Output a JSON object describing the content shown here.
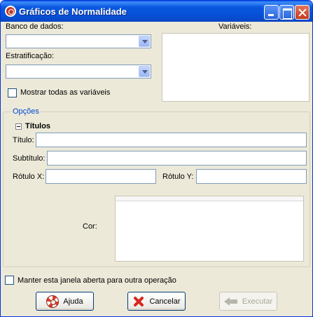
{
  "window": {
    "title": "Gráficos de Normalidade"
  },
  "database": {
    "label": "Banco de dados:",
    "value": ""
  },
  "stratification": {
    "label": "Estratificação:",
    "value": ""
  },
  "variables": {
    "label": "Variáveis:",
    "items": []
  },
  "show_all": {
    "label": "Mostrar todas as variáveis",
    "checked": false
  },
  "options": {
    "legend": "Opções",
    "titles_section": "Títulos",
    "title_label": "Título:",
    "title_value": "",
    "subtitle_label": "Subtítulo:",
    "subtitle_value": "",
    "xlabel_label": "Rótulo X:",
    "xlabel_value": "",
    "ylabel_label": "Rótulo Y:",
    "ylabel_value": "",
    "color_label": "Cor:"
  },
  "keep_open": {
    "label": "Manter esta janela aberta para outra operação",
    "checked": false
  },
  "buttons": {
    "help": "Ajuda",
    "cancel": "Cancelar",
    "execute": "Executar"
  },
  "icons": {
    "app": "app-logo-icon",
    "help": "lifebuoy-icon",
    "cancel": "red-x-icon",
    "execute": "back-arrow-icon"
  }
}
